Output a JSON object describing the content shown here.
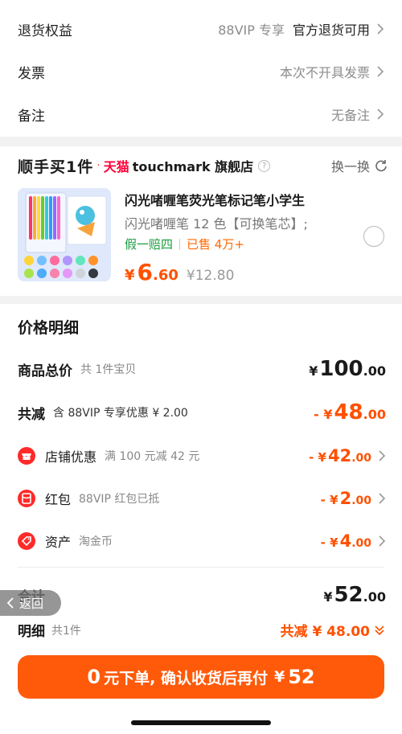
{
  "rows": {
    "refund": {
      "label": "退货权益",
      "tag": "88VIP 专享",
      "value": "官方退货可用"
    },
    "invoice": {
      "label": "发票",
      "value": "本次不开具发票"
    },
    "note": {
      "label": "备注",
      "value": "无备注"
    }
  },
  "shop": {
    "brand": "顺手买1件",
    "dot": "·",
    "platform": "天猫",
    "name": "touchmark 旗舰店",
    "help_icon": "question-circle-icon",
    "swap_label": "换一换"
  },
  "product": {
    "title": "闪光啫喱笔荧光笔标记笔小学生",
    "sku": "闪光啫喱笔 12 色【可换笔芯】;",
    "tag_guarantee": "假一赔四",
    "tag_sold": "已售 4万+",
    "price_symbol": "¥",
    "price_int": "6",
    "price_dec": ".60",
    "price_orig": "¥12.80"
  },
  "details": {
    "title": "价格明细",
    "goods_total": {
      "label": "商品总价",
      "sub": "共 1件宝贝",
      "symbol": "¥",
      "int": "100",
      "dec": ".00"
    },
    "discount_total": {
      "label": "共减",
      "sub": "含 88VIP 专享优惠 ¥ 2.00",
      "symbol": "- ¥",
      "int": "48",
      "dec": ".00"
    },
    "items": [
      {
        "label": "店铺优惠",
        "sub": "满 100 元减 42 元",
        "symbol": "- ¥",
        "int": "42",
        "dec": ".00",
        "icon": "shop-icon"
      },
      {
        "label": "红包",
        "sub": "88VIP 红包已抵",
        "symbol": "- ¥",
        "int": "2",
        "dec": ".00",
        "icon": "red-packet-icon"
      },
      {
        "label": "资产",
        "sub": "淘金币",
        "symbol": "- ¥",
        "int": "4",
        "dec": ".00",
        "icon": "tag-icon"
      }
    ],
    "total": {
      "label": "合计",
      "symbol": "¥",
      "int": "52",
      "dec": ".00"
    },
    "detail": {
      "label": "明细",
      "sub": "共1件",
      "value": "共减 ¥ 48.00"
    }
  },
  "back_label": "返回",
  "cta": {
    "zero": "0",
    "text": "元下单, 确认收货后再付",
    "symbol": "¥",
    "amount": "52"
  },
  "colors": {
    "accent": "#ff5000",
    "button": "#ff5a0a",
    "green": "#1a9c3e",
    "tmall": "#ff0036"
  }
}
